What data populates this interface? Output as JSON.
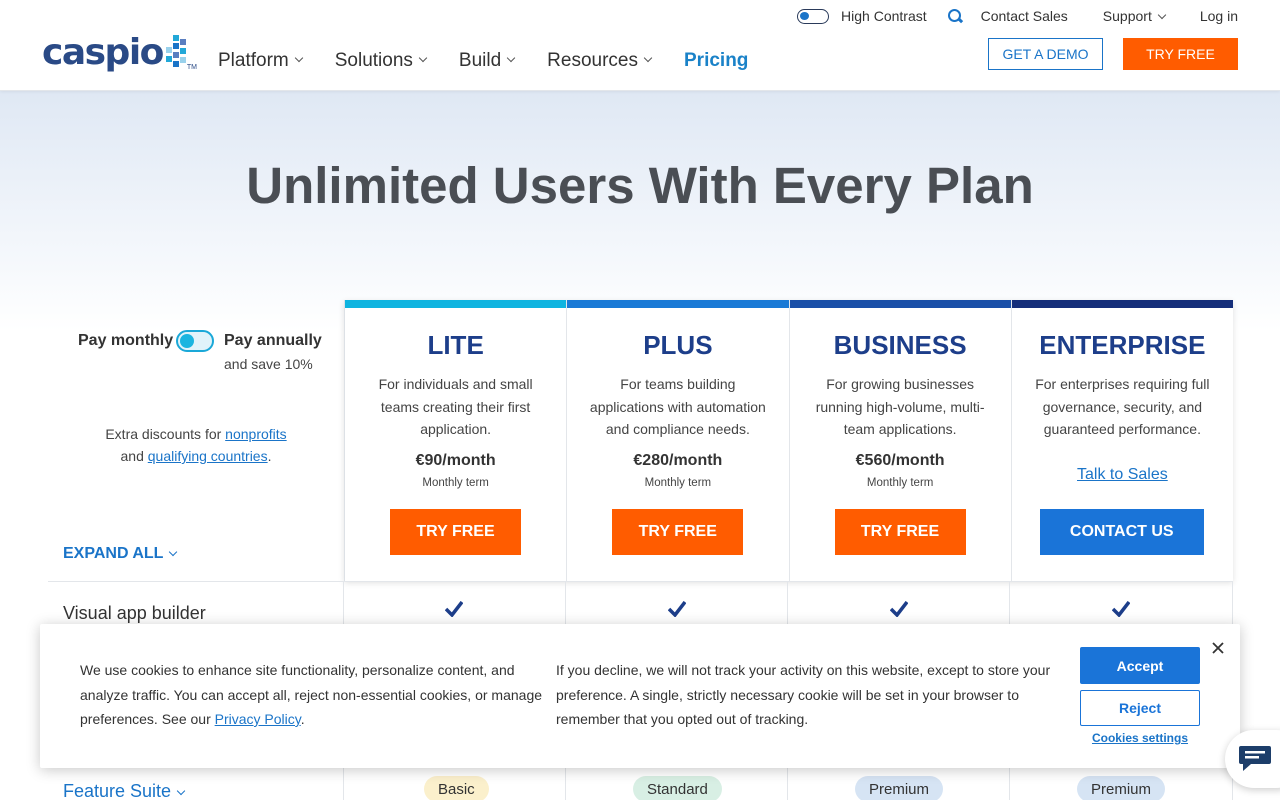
{
  "header": {
    "logo_text": "caspio",
    "logo_tm": "TM",
    "high_contrast_label": "High Contrast",
    "contact_sales": "Contact Sales",
    "support": "Support",
    "login": "Log in",
    "nav": [
      "Platform",
      "Solutions",
      "Build",
      "Resources",
      "Pricing"
    ],
    "demo_button": "GET A DEMO",
    "try_button": "TRY FREE",
    "brand_color": "#2a4a86",
    "accent_orange": "#ff5c00",
    "link_blue": "#1a74c8"
  },
  "hero": {
    "title": "Unlimited Users With Every Plan"
  },
  "billing": {
    "pay_monthly": "Pay monthly",
    "pay_annually": "Pay annually",
    "save_note": "and save 10%",
    "discount_prefix": "Extra discounts for",
    "nonprofits_link": "nonprofits",
    "and_text": "and",
    "countries_link": "qualifying countries",
    "period": ".",
    "expand_all": "EXPAND ALL"
  },
  "plans": [
    {
      "name": "LITE",
      "description": "For individuals and small teams creating their first application.",
      "price": "€90/month",
      "term": "Monthly term",
      "button": "TRY FREE",
      "bar_color": "#0fb4e0"
    },
    {
      "name": "PLUS",
      "description": "For teams building applications with automation and compliance needs.",
      "price": "€280/month",
      "term": "Monthly term",
      "button": "TRY FREE",
      "bar_color": "#1a7ad6"
    },
    {
      "name": "BUSINESS",
      "description": "For growing businesses running high-volume, multi-team applications.",
      "price": "€560/month",
      "term": "Monthly term",
      "button": "TRY FREE",
      "bar_color": "#1a4fa8"
    },
    {
      "name": "ENTERPRISE",
      "description": "For enterprises requiring full governance, security, and guaranteed performance.",
      "talk_link": "Talk to Sales",
      "button": "CONTACT US",
      "bar_color": "#152e7a"
    }
  ],
  "features": {
    "visual_builder": "Visual app builder",
    "feature_suite": "Feature Suite",
    "suite_badges": [
      {
        "label": "Basic",
        "color": "#fbf0cc"
      },
      {
        "label": "Standard",
        "color": "#d8efe4"
      },
      {
        "label": "Premium",
        "color": "#d6e4f4"
      },
      {
        "label": "Premium",
        "color": "#d6e4f4"
      }
    ]
  },
  "cookie": {
    "left_text_a": "We use cookies to enhance site functionality, personalize content, and analyze traffic. You can accept all, reject non-essential cookies, or manage preferences. See our ",
    "privacy_link": "Privacy Policy",
    "left_text_b": ".",
    "right_text": "If you decline, we will not track your activity on this website, except to store your preference. A single, strictly necessary cookie will be set in your browser to remember that you opted out of tracking.",
    "accept": "Accept",
    "reject": "Reject",
    "settings": "Cookies settings"
  }
}
